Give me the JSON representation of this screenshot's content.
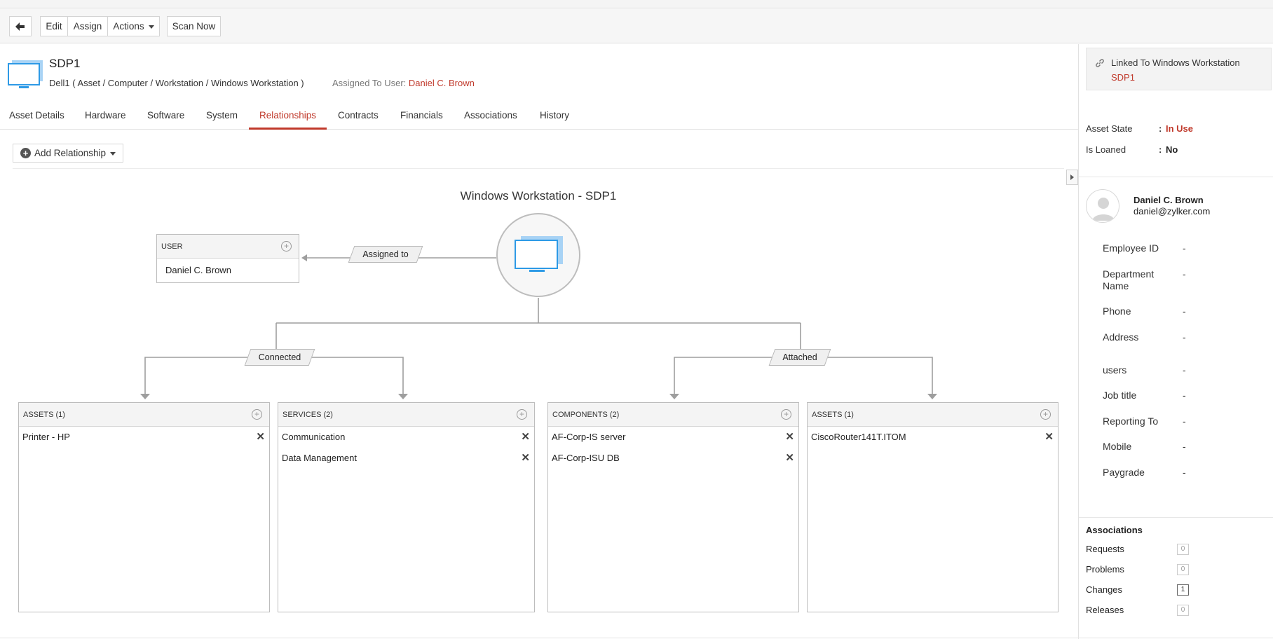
{
  "toolbar": {
    "back_icon": "arrow-left-icon",
    "edit_label": "Edit",
    "assign_label": "Assign",
    "actions_label": "Actions",
    "scan_label": "Scan Now"
  },
  "asset": {
    "name": "SDP1",
    "path": "Dell1 ( Asset / Computer / Workstation / Windows Workstation )",
    "assigned_label": "Assigned To User:",
    "assigned_user": "Daniel C. Brown"
  },
  "tabs": [
    {
      "label": "Asset Details"
    },
    {
      "label": "Hardware"
    },
    {
      "label": "Software"
    },
    {
      "label": "System"
    },
    {
      "label": "Relationships",
      "active": true
    },
    {
      "label": "Contracts"
    },
    {
      "label": "Financials"
    },
    {
      "label": "Associations"
    },
    {
      "label": "History"
    }
  ],
  "add_relationship_label": "Add Relationship",
  "diagram": {
    "title": "Windows Workstation - SDP1",
    "user_box": {
      "header": "USER",
      "value": "Daniel C. Brown"
    },
    "labels": {
      "assigned_to": "Assigned to",
      "connected": "Connected",
      "attached": "Attached"
    },
    "boxes": [
      {
        "header": "ASSETS (1)",
        "items": [
          "Printer - HP"
        ]
      },
      {
        "header": "SERVICES (2)",
        "items": [
          "Communication",
          "Data Management"
        ]
      },
      {
        "header": "COMPONENTS (2)",
        "items": [
          "AF-Corp-IS server",
          "AF-Corp-ISU DB"
        ]
      },
      {
        "header": "ASSETS (1)",
        "items": [
          "CiscoRouter141T.ITOM"
        ]
      }
    ]
  },
  "right_panel": {
    "linked_title": "Linked To Windows Workstation",
    "linked_value": "SDP1",
    "asset_state_label": "Asset State",
    "asset_state_value": "In Use",
    "is_loaned_label": "Is Loaned",
    "is_loaned_value": "No",
    "colon": ":",
    "user_name": "Daniel C. Brown",
    "user_email": "daniel@zylker.com",
    "fields": [
      {
        "label": "Employee ID",
        "value": "-"
      },
      {
        "label": "Department Name",
        "value": "-"
      },
      {
        "label": "Phone",
        "value": "-"
      },
      {
        "label": "Address",
        "value": "-"
      },
      {
        "label": "users",
        "value": "-"
      },
      {
        "label": "Job title",
        "value": "-"
      },
      {
        "label": "Reporting To",
        "value": "-"
      },
      {
        "label": "Mobile",
        "value": "-"
      },
      {
        "label": "Paygrade",
        "value": "-"
      }
    ],
    "associations_title": "Associations",
    "associations": [
      {
        "label": "Requests",
        "count": "0"
      },
      {
        "label": "Problems",
        "count": "0"
      },
      {
        "label": "Changes",
        "count": "1"
      },
      {
        "label": "Releases",
        "count": "0"
      }
    ]
  },
  "colors": {
    "accent": "#c0392b",
    "monitor_blue": "#2e9ae6"
  }
}
